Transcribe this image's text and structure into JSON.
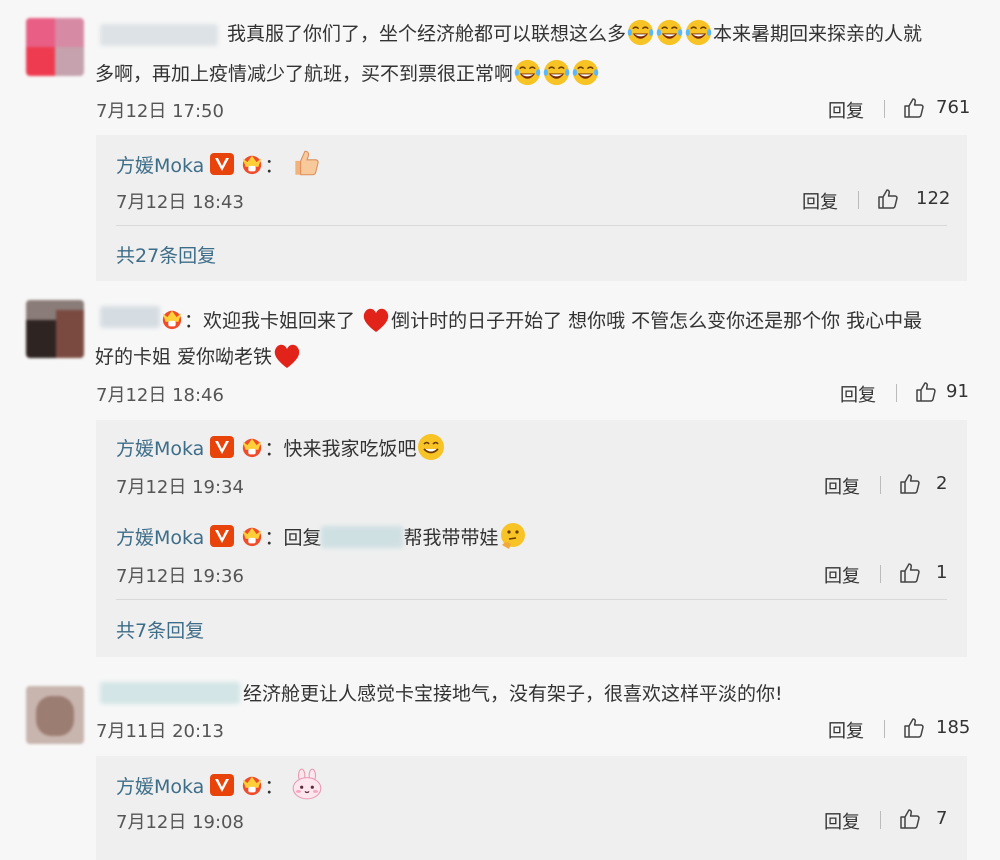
{
  "comments": [
    {
      "text_a": "我真服了你们了，坐个经济舱都可以联想这么多",
      "text_b": "本来暑期回来探亲的人就",
      "text_c": "多啊，再加上疫情减少了航班，买不到票很正常啊",
      "time": "7月12日 17:50",
      "reply_label": "回复",
      "likes": "761",
      "replies": [
        {
          "name": "方媛Moka",
          "suffix": "：",
          "time": "7月12日 18:43",
          "reply_label": "回复",
          "likes": "122"
        }
      ],
      "more": "共27条回复"
    },
    {
      "text_a": "：欢迎我卡姐回来了",
      "text_b": "倒计时的日子开始了 想你哦 不管怎么变你还是那个你 我心中最",
      "text_c": "好的卡姐 爱你呦老铁",
      "time": "7月12日 18:46",
      "reply_label": "回复",
      "likes": "91",
      "replies": [
        {
          "name": "方媛Moka",
          "text": "：快来我家吃饭吧",
          "time": "7月12日 19:34",
          "reply_label": "回复",
          "likes": "2"
        },
        {
          "name": "方媛Moka",
          "text_a": "：回复",
          "text_b": "帮我带带娃",
          "time": "7月12日 19:36",
          "reply_label": "回复",
          "likes": "1"
        }
      ],
      "more": "共7条回复"
    },
    {
      "text_a": "经济舱更让人感觉卡宝接地气，没有架子，很喜欢这样平淡的你!",
      "time": "7月11日 20:13",
      "reply_label": "回复",
      "likes": "185",
      "replies": [
        {
          "name": "方媛Moka",
          "suffix": "：",
          "time": "7月12日 19:08",
          "reply_label": "回复",
          "likes": "7"
        }
      ]
    }
  ],
  "icons": {
    "like": "thumbs-up-icon",
    "vip": "v-badge-icon",
    "fan": "fan-crown-icon",
    "laugh": "laughing-emoji-icon",
    "heart": "heart-emoji-icon",
    "thumbs": "thumbs-up-emoji-icon",
    "grin": "grinning-emoji-icon",
    "think": "thinking-emoji-icon",
    "bunny": "bunny-emoji-icon"
  },
  "colors": {
    "name": "#3e6d88",
    "badge": "#e8430b",
    "heart": "#e2231a",
    "emoji": "#f7c325"
  }
}
